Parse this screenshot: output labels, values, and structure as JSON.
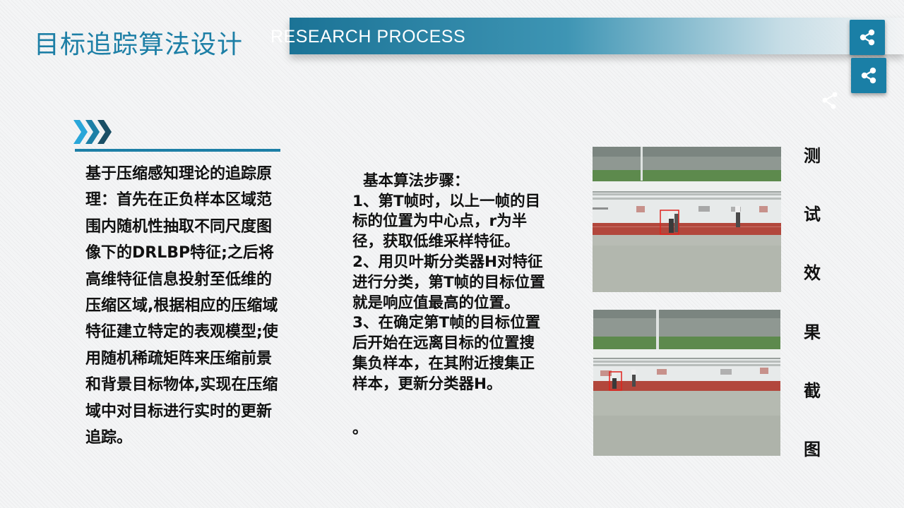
{
  "header": {
    "title": "目标追踪算法设计",
    "banner_text": "RESEARCH PROCESS"
  },
  "icons": {
    "share_primary": "share-icon",
    "share_secondary": "share-icon",
    "chevrons": "triple-chevron-right-icon"
  },
  "colors": {
    "accent": "#1d7fa6",
    "banner_dark": "#1b7396",
    "chevron_light": "#29a6d9",
    "tracking_box": "#e0231c"
  },
  "left_column": {
    "text": "基于压缩感知理论的追踪原理：首先在正负样本区域范围内随机性抽取不同尺度图像下的DRLBP特征;之后将高维特征信息投射至低维的压缩区域,根据相应的压缩域特征建立特定的表观模型;使用随机稀疏矩阵来压缩前景和背景目标物体,实现在压缩域中对目标进行实时的更新追踪。"
  },
  "middle_column": {
    "text": "基本算法步骤：\n1、第T帧时，以上一帧的目标的位置为中心点，r为半径，获取低维采样特征。\n2、用贝叶斯分类器H对特征进行分类，第T帧的目标位置就是响应值最高的位置。\n3、在确定第T帧的目标位置后开始在远离目标的位置搜集负样本，在其附近搜集正样本，更新分类器H。",
    "trailing_mark": "。"
  },
  "right_label": {
    "chars": [
      "测",
      "试",
      "效",
      "果",
      "截",
      "图"
    ]
  }
}
